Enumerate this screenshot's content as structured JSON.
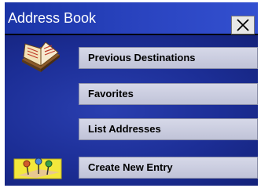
{
  "window": {
    "title": "Address Book"
  },
  "menu": [
    {
      "id": "btn-prev",
      "label": "Previous Destinations"
    },
    {
      "id": "btn-fav",
      "label": " Favorites"
    },
    {
      "id": "btn-list",
      "label": "List Addresses"
    },
    {
      "id": "btn-new",
      "label": "Create New Entry"
    }
  ],
  "icons": {
    "address-book": "book-icon",
    "new-entry": "pins-icon",
    "close": "close-icon"
  }
}
